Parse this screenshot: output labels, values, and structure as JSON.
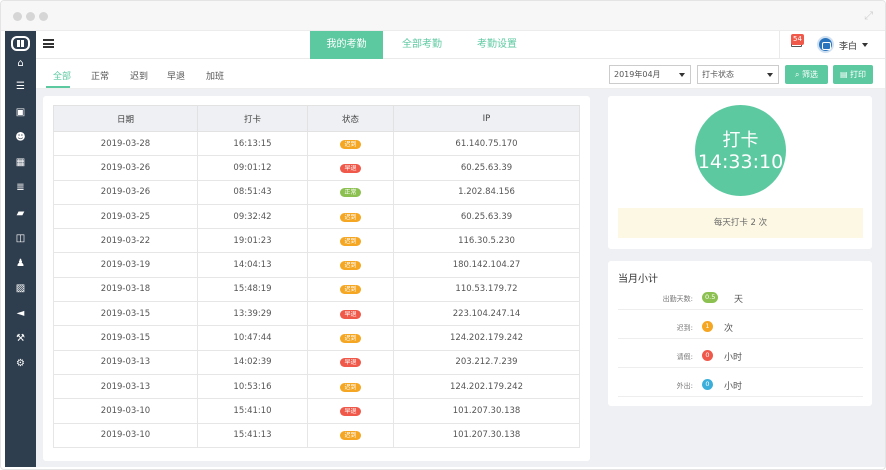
{
  "nav": {
    "tabs": [
      {
        "label": "我的考勤",
        "active": true
      },
      {
        "label": "全部考勤",
        "active": false
      },
      {
        "label": "考勤设置",
        "active": false
      }
    ],
    "mail_count": "54",
    "user_name": "李白"
  },
  "filters": {
    "tabs": [
      "全部",
      "正常",
      "迟到",
      "早退",
      "加班"
    ],
    "active_tab": "全部",
    "month_select": "2019年04月",
    "status_select": "打卡状态",
    "filter_button": "筛选",
    "print_button": "打印"
  },
  "table": {
    "headers": [
      "日期",
      "打卡",
      "状态",
      "IP"
    ],
    "rows": [
      {
        "date": "2019-03-28",
        "time": "16:13:15",
        "status": "迟到",
        "ip": "61.140.75.170"
      },
      {
        "date": "2019-03-26",
        "time": "09:01:12",
        "status": "早退",
        "ip": "60.25.63.39"
      },
      {
        "date": "2019-03-26",
        "time": "08:51:43",
        "status": "正常",
        "ip": "1.202.84.156"
      },
      {
        "date": "2019-03-25",
        "time": "09:32:42",
        "status": "迟到",
        "ip": "60.25.63.39"
      },
      {
        "date": "2019-03-22",
        "time": "19:01:23",
        "status": "迟到",
        "ip": "116.30.5.230"
      },
      {
        "date": "2019-03-19",
        "time": "14:04:13",
        "status": "迟到",
        "ip": "180.142.104.27"
      },
      {
        "date": "2019-03-18",
        "time": "15:48:19",
        "status": "迟到",
        "ip": "110.53.179.72"
      },
      {
        "date": "2019-03-15",
        "time": "13:39:29",
        "status": "早退",
        "ip": "223.104.247.14"
      },
      {
        "date": "2019-03-15",
        "time": "10:47:44",
        "status": "迟到",
        "ip": "124.202.179.242"
      },
      {
        "date": "2019-03-13",
        "time": "14:02:39",
        "status": "早退",
        "ip": "203.212.7.239"
      },
      {
        "date": "2019-03-13",
        "time": "10:53:16",
        "status": "迟到",
        "ip": "124.202.179.242"
      },
      {
        "date": "2019-03-10",
        "time": "15:41:10",
        "status": "早退",
        "ip": "101.207.30.138"
      },
      {
        "date": "2019-03-10",
        "time": "15:41:13",
        "status": "迟到",
        "ip": "101.207.30.138"
      }
    ]
  },
  "status_colors": {
    "迟到": "#f5a623",
    "早退": "#f0594a",
    "正常": "#8cc152"
  },
  "punch": {
    "label": "打卡",
    "time": "14:33:10",
    "notice": "每天打卡 2 次"
  },
  "summary": {
    "title": "当月小计",
    "items": [
      {
        "label": "出勤天数:",
        "value": "0.5",
        "unit": "天",
        "color": "#8cc152"
      },
      {
        "label": "迟到:",
        "value": "1",
        "unit": "次",
        "color": "#f5a623"
      },
      {
        "label": "请假:",
        "value": "0",
        "unit": "小时",
        "color": "#f0594a"
      },
      {
        "label": "外出:",
        "value": "0",
        "unit": "小时",
        "color": "#3bafda"
      }
    ]
  },
  "sidebar_icons": [
    "logo-icon",
    "home-icon",
    "list-icon",
    "briefcase-icon",
    "users-icon",
    "calendar-icon",
    "menu-list-icon",
    "book-icon",
    "columns-icon",
    "person-icon",
    "image-icon",
    "megaphone-icon",
    "gavel-icon",
    "settings-icon"
  ]
}
